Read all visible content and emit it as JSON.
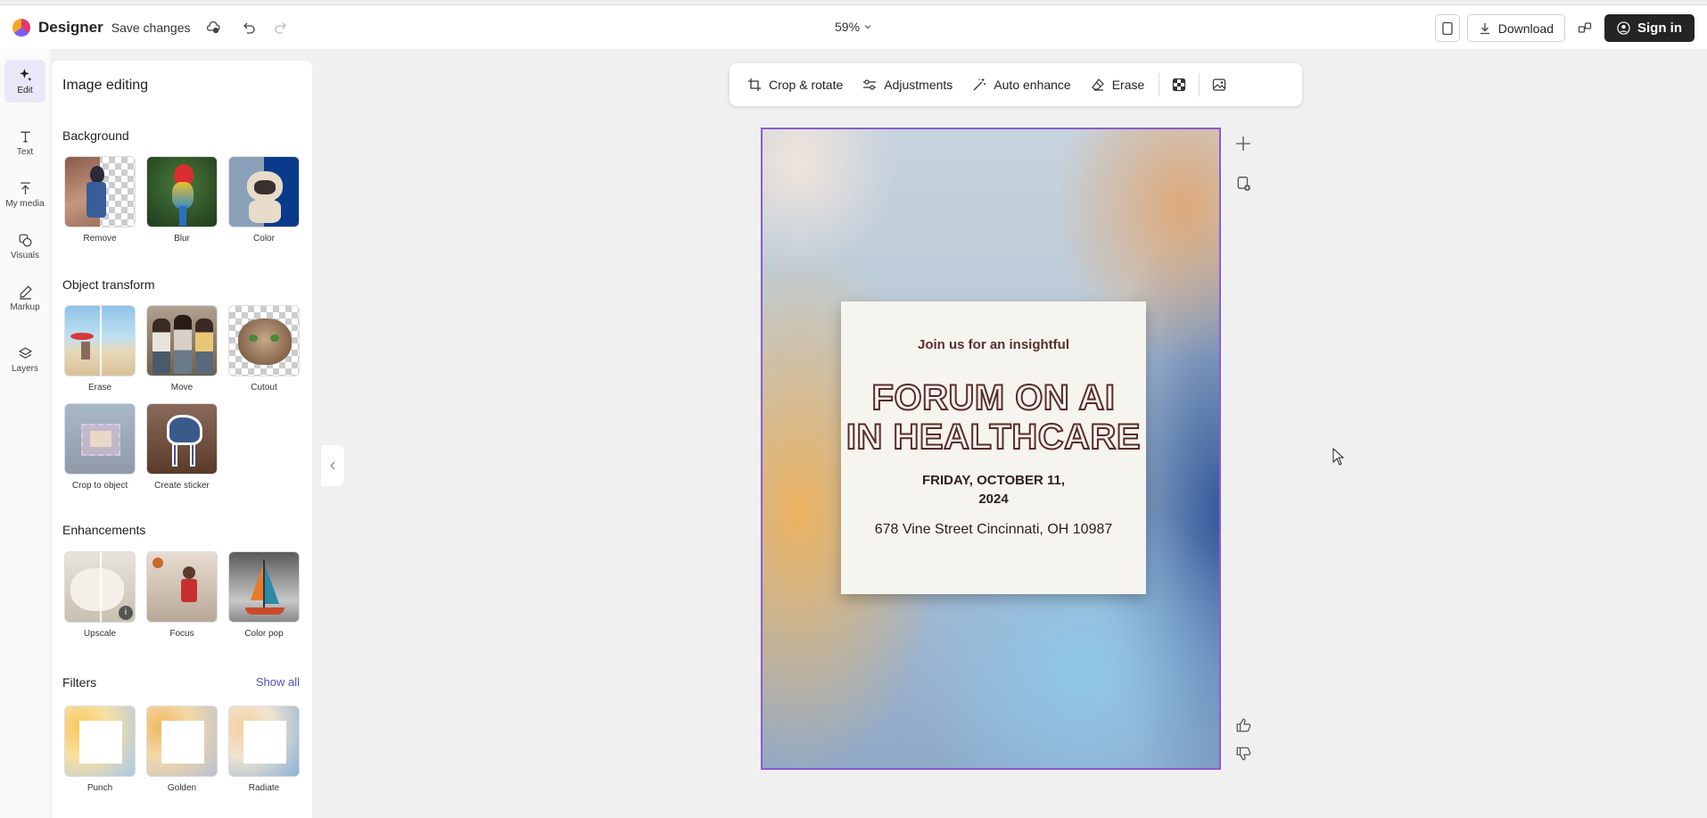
{
  "app": {
    "name": "Designer",
    "save_label": "Save changes",
    "zoom": "59%"
  },
  "topbar": {
    "download": "Download",
    "sign_in": "Sign in"
  },
  "rail": [
    {
      "id": "edit",
      "label": "Edit",
      "icon": "sparkle-icon",
      "active": true
    },
    {
      "id": "text",
      "label": "Text",
      "icon": "text-icon"
    },
    {
      "id": "my-media",
      "label": "My media",
      "icon": "upload-icon"
    },
    {
      "id": "visuals",
      "label": "Visuals",
      "icon": "shapes-icon"
    },
    {
      "id": "markup",
      "label": "Markup",
      "icon": "pen-icon"
    },
    {
      "id": "layers",
      "label": "Layers",
      "icon": "layers-icon"
    }
  ],
  "panel": {
    "title": "Image editing",
    "background": {
      "heading": "Background",
      "items": [
        "Remove",
        "Blur",
        "Color"
      ]
    },
    "object_transform": {
      "heading": "Object transform",
      "items": [
        "Erase",
        "Move",
        "Cutout",
        "Crop to object",
        "Create sticker"
      ]
    },
    "enhancements": {
      "heading": "Enhancements",
      "items": [
        "Upscale",
        "Focus",
        "Color pop"
      ]
    },
    "filters": {
      "heading": "Filters",
      "show_all": "Show all",
      "items": [
        "Punch",
        "Golden",
        "Radiate"
      ]
    }
  },
  "toolbar": {
    "crop": "Crop & rotate",
    "adjustments": "Adjustments",
    "auto_enhance": "Auto enhance",
    "erase": "Erase"
  },
  "design": {
    "intro": "Join us for an insightful",
    "title_line1": "FORUM ON AI",
    "title_line2": "IN HEALTHCARE",
    "date_line1": "FRIDAY, OCTOBER 11,",
    "date_line2": "2024",
    "address": "678 Vine Street Cincinnati, OH 10987"
  },
  "colors": {
    "accent": "#8a5cd0",
    "link": "#4a52b7",
    "primary_button": "#242424"
  }
}
